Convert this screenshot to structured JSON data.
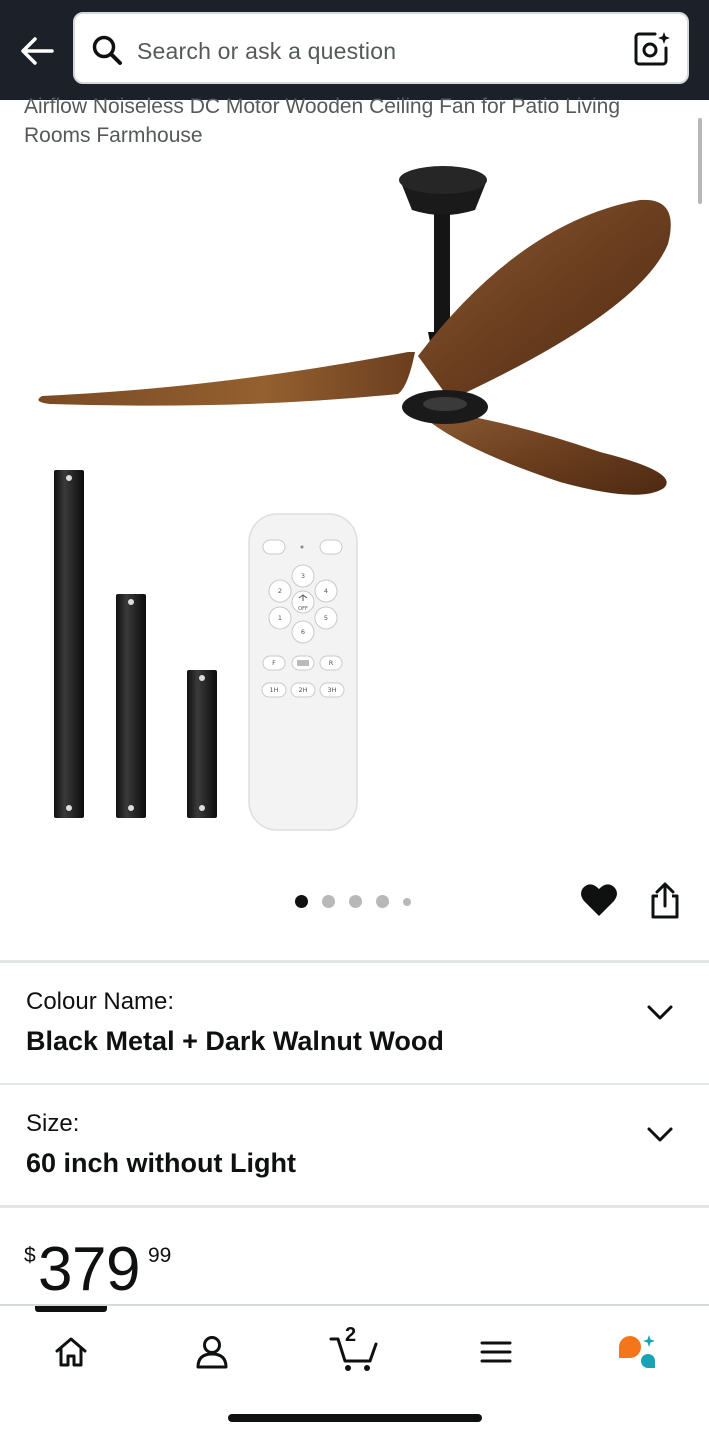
{
  "header": {
    "search_placeholder": "Search or ask a question"
  },
  "product": {
    "title": "Airflow Noiseless DC Motor Wooden Ceiling Fan for Patio Living Rooms Farmhouse",
    "image_count": 5,
    "image_active_index": 0,
    "remote_labels": [
      "3",
      "2",
      "4",
      "1",
      "5",
      "6",
      "OFF",
      "F",
      "R",
      "1H",
      "2H",
      "3H"
    ]
  },
  "variations": {
    "colour": {
      "label": "Colour Name:",
      "value": "Black Metal + Dark Walnut Wood"
    },
    "size": {
      "label": "Size:",
      "value": "60 inch without Light"
    }
  },
  "price": {
    "currency": "$",
    "whole": "379",
    "fraction": "99"
  },
  "bottom_nav": {
    "active": "home",
    "cart_count": "2",
    "items": [
      "home-icon",
      "account-icon",
      "cart-icon",
      "menu-icon",
      "rufus-icon"
    ]
  },
  "colors": {
    "header_bg": "#1b2029",
    "text": "#0f1111",
    "secondary_text": "#565959",
    "separator": "#e3e6e6",
    "rufus_orange": "#f3761b",
    "rufus_teal": "#1aa3b6",
    "wood": "#6b3e1f"
  }
}
